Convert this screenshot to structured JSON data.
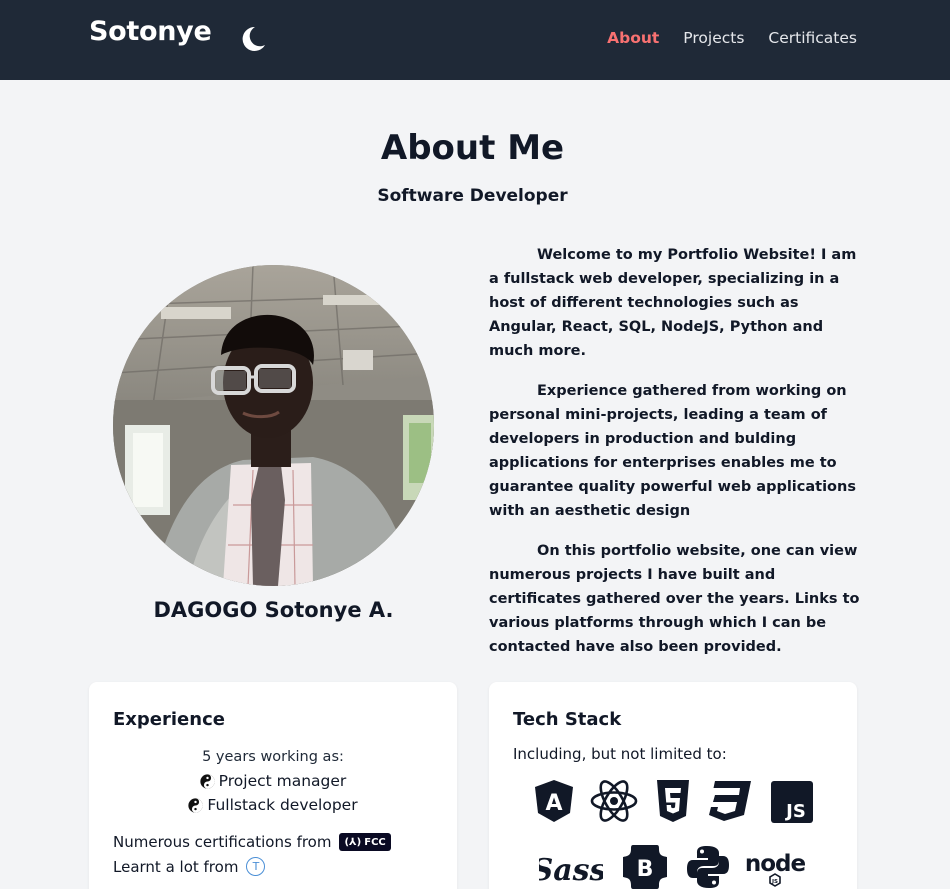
{
  "nav": {
    "brand": "Sotonye",
    "links": [
      "About",
      "Projects",
      "Certificates"
    ],
    "active": "About"
  },
  "header": {
    "title": "About Me",
    "subtitle": "Software Developer"
  },
  "profile": {
    "name": "DAGOGO Sotonye A."
  },
  "bio": {
    "paragraphs": [
      "Welcome to my Portfolio Website! I am a fullstack web developer, specializing in a host of different technologies such as Angular, React, SQL, NodeJS, Python and much more.",
      "Experience gathered from working on personal mini-projects, leading a team of developers in production and bulding applications for enterprises enables me to guarantee quality powerful web applications with an aesthetic design",
      "On this portfolio website, one can view numerous projects I have built and certificates gathered over the years. Links to various platforms through which I can be contacted have also been provided."
    ]
  },
  "experience": {
    "title": "Experience",
    "years": "5 years working as:",
    "roles": [
      "Project manager",
      "Fullstack developer"
    ],
    "certs_line": "Numerous certifications from",
    "fcc_badge": "FCC",
    "learnt_line": "Learnt a lot from",
    "learnt_badge": "T"
  },
  "tech": {
    "title": "Tech Stack",
    "intro": "Including, but not limited to:",
    "icons": [
      "angular-icon",
      "react-icon",
      "html5-icon",
      "css3-icon",
      "javascript-icon",
      "sass-icon",
      "bootstrap-icon",
      "python-icon",
      "nodejs-icon"
    ],
    "sass_label": "Sass",
    "node_label": "node",
    "js_label": "JS",
    "bootstrap_label": "B"
  },
  "colors": {
    "navbar": "#1f2937",
    "accent": "#f87171",
    "background": "#f3f4f6"
  }
}
